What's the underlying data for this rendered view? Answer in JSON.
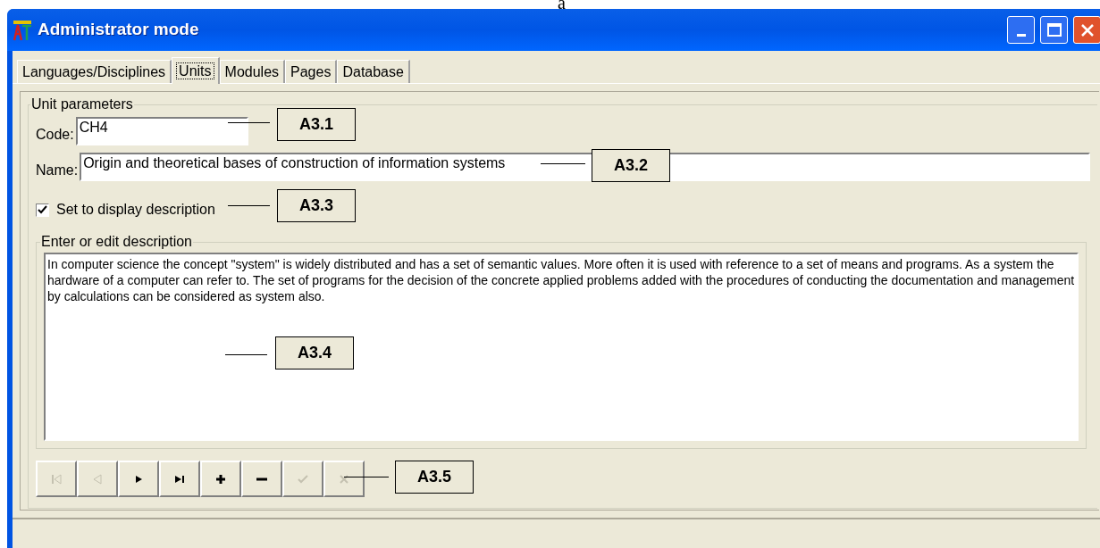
{
  "caption_fragment": "a",
  "window": {
    "title": "Administrator mode"
  },
  "tabs": [
    {
      "label": "Languages/Disciplines",
      "selected": false
    },
    {
      "label": "Units",
      "selected": true
    },
    {
      "label": "Modules",
      "selected": false
    },
    {
      "label": "Pages",
      "selected": false
    },
    {
      "label": "Database",
      "selected": false
    }
  ],
  "unit_parameters": {
    "title": "Unit parameters",
    "code": {
      "label": "Code:",
      "value": "CH4"
    },
    "name": {
      "label": "Name:",
      "value": "Origin and theoretical bases of construction of information systems"
    },
    "display_description": {
      "label": "Set to display description",
      "checked": true
    }
  },
  "description": {
    "title": "Enter or edit description",
    "value": "In computer science the concept \"system\" is widely distributed and has a set  of semantic values. More often it is used with reference to a set of means and programs. As a system the hardware of a computer can refer to. The set of programs for the decision of the concrete applied problems  added with the procedures of conducting  the documentation and management by calculations can be considered as system also."
  },
  "navigator": [
    {
      "kind": "first",
      "disabled": true
    },
    {
      "kind": "prior",
      "disabled": true
    },
    {
      "kind": "next",
      "disabled": false
    },
    {
      "kind": "last",
      "disabled": false
    },
    {
      "kind": "insert",
      "disabled": false
    },
    {
      "kind": "delete",
      "disabled": false
    },
    {
      "kind": "post",
      "disabled": true
    },
    {
      "kind": "cancel",
      "disabled": true
    }
  ],
  "annotations": [
    {
      "label": "A3.1"
    },
    {
      "label": "A3.2"
    },
    {
      "label": "A3.3"
    },
    {
      "label": "A3.4"
    },
    {
      "label": "A3.5"
    }
  ]
}
